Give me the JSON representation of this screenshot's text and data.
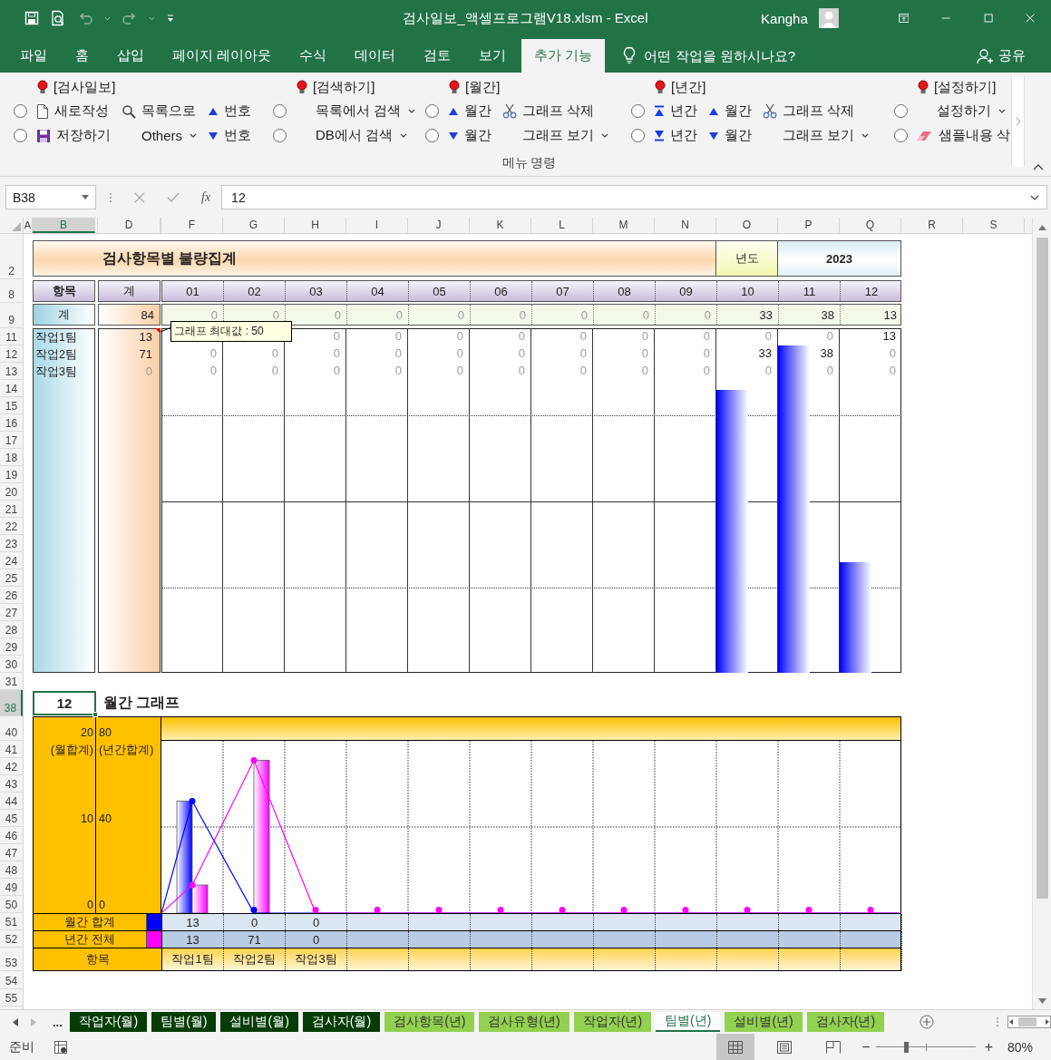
{
  "title_bar": {
    "title": "검사일보_액셀프로그램V18.xlsm - Excel",
    "user": "Kangha"
  },
  "ribbon_tabs": [
    {
      "label": "파일",
      "selected": false
    },
    {
      "label": "홈",
      "selected": false
    },
    {
      "label": "삽입",
      "selected": false
    },
    {
      "label": "페이지 레이아웃",
      "selected": false
    },
    {
      "label": "수식",
      "selected": false
    },
    {
      "label": "데이터",
      "selected": false
    },
    {
      "label": "검토",
      "selected": false
    },
    {
      "label": "보기",
      "selected": false
    },
    {
      "label": "추가 기능",
      "selected": true
    }
  ],
  "tell_me": {
    "placeholder": "어떤 작업을 원하시나요?"
  },
  "share": "공유",
  "ribbon_groups": [
    {
      "title": "[검사일보]",
      "items": [
        {
          "kind": "radio",
          "checked": false
        },
        {
          "kind": "radio",
          "checked": false
        },
        {
          "kind": "new",
          "label": "새로작성"
        },
        {
          "kind": "save",
          "label": "저장하기"
        },
        {
          "kind": "search",
          "label": "목록으로"
        },
        {
          "kind": "dropdown",
          "label": "Others"
        },
        {
          "kind": "up",
          "label": "번호"
        },
        {
          "kind": "down",
          "label": "번호"
        }
      ]
    },
    {
      "title": "[검색하기]",
      "items": [
        {
          "kind": "radio",
          "checked": false
        },
        {
          "kind": "radio",
          "checked": false
        },
        {
          "kind": "dropdown",
          "label": "목록에서 검색"
        },
        {
          "kind": "dropdown",
          "label": "DB에서 검색"
        }
      ]
    },
    {
      "title": "[월간]",
      "items": [
        {
          "kind": "radio",
          "checked": false
        },
        {
          "kind": "radio",
          "checked": false
        },
        {
          "kind": "up",
          "label": "월간"
        },
        {
          "kind": "down",
          "label": "월간"
        },
        {
          "kind": "cut",
          "label": "그래프 삭제"
        },
        {
          "kind": "dropdown",
          "label": "그래프 보기"
        }
      ]
    },
    {
      "title": "[년간]",
      "items": [
        {
          "kind": "radio",
          "checked": false
        },
        {
          "kind": "radio",
          "checked": false
        },
        {
          "kind": "first",
          "label": "년간"
        },
        {
          "kind": "last",
          "label": "년간"
        },
        {
          "kind": "up",
          "label": "월간"
        },
        {
          "kind": "down",
          "label": "월간"
        },
        {
          "kind": "cut",
          "label": "그래프 삭제"
        },
        {
          "kind": "dropdown",
          "label": "그래프 보기"
        }
      ]
    },
    {
      "title": "[설정하기]",
      "items": [
        {
          "kind": "radio",
          "checked": false
        },
        {
          "kind": "radio",
          "checked": false
        },
        {
          "kind": "dropdown",
          "label": "설정하기"
        },
        {
          "kind": "erase",
          "label": "샘플내용 삭"
        }
      ]
    }
  ],
  "ribbon_footer": "메뉴 명령",
  "formula_bar": {
    "name_box": "B38",
    "function_label": "fx",
    "formula": "12"
  },
  "columns": [
    {
      "label": "A",
      "selected": false
    },
    {
      "label": "B",
      "selected": true
    },
    {
      "label": "D",
      "selected": false
    },
    {
      "label": "F",
      "selected": false
    },
    {
      "label": "G",
      "selected": false
    },
    {
      "label": "H",
      "selected": false
    },
    {
      "label": "I",
      "selected": false
    },
    {
      "label": "J",
      "selected": false
    },
    {
      "label": "K",
      "selected": false
    },
    {
      "label": "L",
      "selected": false
    },
    {
      "label": "M",
      "selected": false
    },
    {
      "label": "N",
      "selected": false
    },
    {
      "label": "O",
      "selected": false
    },
    {
      "label": "P",
      "selected": false
    },
    {
      "label": "Q",
      "selected": false
    },
    {
      "label": "R",
      "selected": false
    },
    {
      "label": "S",
      "selected": false
    }
  ],
  "rows": [
    {
      "label": "2",
      "selected": false
    },
    {
      "label": "8",
      "selected": false
    },
    {
      "label": "9",
      "selected": false
    },
    {
      "label": "11",
      "selected": false
    },
    {
      "label": "12",
      "selected": false
    },
    {
      "label": "13",
      "selected": false
    },
    {
      "label": "14",
      "selected": false
    },
    {
      "label": "15",
      "selected": false
    },
    {
      "label": "16",
      "selected": false
    },
    {
      "label": "17",
      "selected": false
    },
    {
      "label": "18",
      "selected": false
    },
    {
      "label": "19",
      "selected": false
    },
    {
      "label": "20",
      "selected": false
    },
    {
      "label": "21",
      "selected": false
    },
    {
      "label": "22",
      "selected": false
    },
    {
      "label": "23",
      "selected": false
    },
    {
      "label": "24",
      "selected": false
    },
    {
      "label": "25",
      "selected": false
    },
    {
      "label": "26",
      "selected": false
    },
    {
      "label": "27",
      "selected": false
    },
    {
      "label": "28",
      "selected": false
    },
    {
      "label": "29",
      "selected": false
    },
    {
      "label": "30",
      "selected": false
    },
    {
      "label": "31",
      "selected": false
    },
    {
      "label": "38",
      "selected": true
    },
    {
      "label": "40",
      "selected": false
    },
    {
      "label": "41",
      "selected": false
    },
    {
      "label": "42",
      "selected": false
    },
    {
      "label": "43",
      "selected": false
    },
    {
      "label": "44",
      "selected": false
    },
    {
      "label": "45",
      "selected": false
    },
    {
      "label": "46",
      "selected": false
    },
    {
      "label": "47",
      "selected": false
    },
    {
      "label": "48",
      "selected": false
    },
    {
      "label": "49",
      "selected": false
    },
    {
      "label": "50",
      "selected": false
    },
    {
      "label": "51",
      "selected": false
    },
    {
      "label": "52",
      "selected": false
    },
    {
      "label": "53",
      "selected": false
    },
    {
      "label": "54",
      "selected": false
    },
    {
      "label": "55",
      "selected": false
    }
  ],
  "summary_table": {
    "title": "검사항목별 불량집계",
    "year_label": "년도",
    "year": "2023",
    "head": {
      "item": "항목",
      "total": "계"
    },
    "months": [
      {
        "label": "01"
      },
      {
        "label": "02"
      },
      {
        "label": "03"
      },
      {
        "label": "04"
      },
      {
        "label": "05"
      },
      {
        "label": "06"
      },
      {
        "label": "07"
      },
      {
        "label": "08"
      },
      {
        "label": "09"
      },
      {
        "label": "10",
        "level": 0.82
      },
      {
        "label": "11",
        "level": 0.95
      },
      {
        "label": "12",
        "level": 0.32
      }
    ],
    "total_row": {
      "label": "계",
      "total": {
        "text": "84",
        "muted": false
      },
      "cells": [
        {
          "text": "0",
          "muted": true
        },
        {
          "text": "0",
          "muted": true
        },
        {
          "text": "0",
          "muted": true
        },
        {
          "text": "0",
          "muted": true
        },
        {
          "text": "0",
          "muted": true
        },
        {
          "text": "0",
          "muted": true
        },
        {
          "text": "0",
          "muted": true
        },
        {
          "text": "0",
          "muted": true
        },
        {
          "text": "0",
          "muted": true
        },
        {
          "text": "33",
          "muted": false
        },
        {
          "text": "38",
          "muted": false
        },
        {
          "text": "13",
          "muted": false
        }
      ]
    },
    "rows": [
      {
        "label": "작업1팀",
        "total": {
          "text": "13",
          "muted": false
        },
        "cells": [
          null,
          null,
          {
            "text": "0",
            "muted": true
          },
          {
            "text": "0",
            "muted": true
          },
          {
            "text": "0",
            "muted": true
          },
          {
            "text": "0",
            "muted": true
          },
          {
            "text": "0",
            "muted": true
          },
          {
            "text": "0",
            "muted": true
          },
          {
            "text": "0",
            "muted": true
          },
          {
            "text": "0",
            "muted": true
          },
          {
            "text": "0",
            "muted": true
          },
          {
            "text": "13",
            "muted": false
          }
        ]
      },
      {
        "label": "작업2팀",
        "total": {
          "text": "71",
          "muted": false
        },
        "cells": [
          {
            "text": "0",
            "muted": true
          },
          {
            "text": "0",
            "muted": true
          },
          {
            "text": "0",
            "muted": true
          },
          {
            "text": "0",
            "muted": true
          },
          {
            "text": "0",
            "muted": true
          },
          {
            "text": "0",
            "muted": true
          },
          {
            "text": "0",
            "muted": true
          },
          {
            "text": "0",
            "muted": true
          },
          {
            "text": "0",
            "muted": true
          },
          {
            "text": "33",
            "muted": false
          },
          {
            "text": "38",
            "muted": false
          },
          {
            "text": "0",
            "muted": true
          }
        ]
      },
      {
        "label": "작업3팀",
        "total": {
          "text": "0",
          "muted": true
        },
        "cells": [
          {
            "text": "0",
            "muted": true
          },
          {
            "text": "0",
            "muted": true
          },
          {
            "text": "0",
            "muted": true
          },
          {
            "text": "0",
            "muted": true
          },
          {
            "text": "0",
            "muted": true
          },
          {
            "text": "0",
            "muted": true
          },
          {
            "text": "0",
            "muted": true
          },
          {
            "text": "0",
            "muted": true
          },
          {
            "text": "0",
            "muted": true
          },
          {
            "text": "0",
            "muted": true
          },
          {
            "text": "0",
            "muted": true
          },
          {
            "text": "0",
            "muted": true
          }
        ]
      }
    ],
    "comment": "그래프 최대값 : 50"
  },
  "monthly": {
    "cell": "12",
    "title": "월간 그래프",
    "left_axis": [
      "20",
      "(월합계)",
      "10",
      "0"
    ],
    "right_axis": [
      "80",
      "(년간합계)",
      "40",
      "0"
    ],
    "series": [
      {
        "name": "월간 합계",
        "color": "#0000ff"
      },
      {
        "name": "년간 전체",
        "color": "#ff00ff"
      }
    ],
    "totals": [
      [
        "13",
        "0",
        "0"
      ],
      [
        "13",
        "71",
        "0"
      ]
    ],
    "category_header": "항목",
    "categories": [
      "작업1팀",
      "작업2팀",
      "작업3팀"
    ]
  },
  "sheet_nav": {
    "more": "..."
  },
  "sheet_tabs": [
    {
      "label": "작업자(월)",
      "kind": "monthly",
      "selected": false
    },
    {
      "label": "팀별(월)",
      "kind": "monthly",
      "selected": false
    },
    {
      "label": "설비별(월)",
      "kind": "monthly",
      "selected": false
    },
    {
      "label": "검사자(월)",
      "kind": "monthly",
      "selected": false
    },
    {
      "label": "검사항목(년)",
      "kind": "yearly",
      "selected": false
    },
    {
      "label": "검사유형(년)",
      "kind": "yearly",
      "selected": false
    },
    {
      "label": "작업자(년)",
      "kind": "yearly",
      "selected": false
    },
    {
      "label": "팀별(년)",
      "kind": "yearly",
      "selected": true
    },
    {
      "label": "설비별(년)",
      "kind": "yearly",
      "selected": false
    },
    {
      "label": "검사자(년)",
      "kind": "yearly",
      "selected": false
    }
  ],
  "status_bar": {
    "text": "준비",
    "views": [
      {
        "kind": "normal",
        "selected": true
      },
      {
        "kind": "page-layout",
        "selected": false
      },
      {
        "kind": "page-break",
        "selected": false
      }
    ],
    "zoom_out": "−",
    "zoom_slider": {
      "level": 0.3
    },
    "zoom_in": "+",
    "zoom": "80%"
  }
}
